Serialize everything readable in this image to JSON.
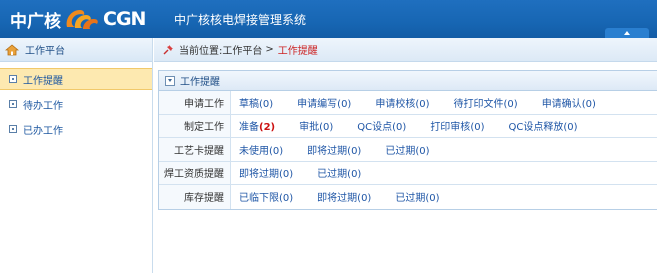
{
  "header": {
    "logo_cn": "中广核",
    "logo_en": "CGN",
    "system_title": "中广核核电焊接管理系统"
  },
  "sidebar": {
    "title": "工作平台",
    "items": [
      {
        "label": "工作提醒",
        "active": true
      },
      {
        "label": "待办工作",
        "active": false
      },
      {
        "label": "已办工作",
        "active": false
      }
    ]
  },
  "breadcrumb": {
    "prefix": "当前位置:",
    "path": "工作平台",
    "separator": ">",
    "current": "工作提醒"
  },
  "panel": {
    "title": "工作提醒",
    "rows": [
      {
        "label": "申请工作",
        "items": [
          {
            "text": "草稿",
            "count": "(0)"
          },
          {
            "text": "申请编写",
            "count": "(0)"
          },
          {
            "text": "申请校核",
            "count": "(0)"
          },
          {
            "text": "待打印文件",
            "count": "(0)"
          },
          {
            "text": "申请确认",
            "count": "(0)"
          }
        ]
      },
      {
        "label": "制定工作",
        "items": [
          {
            "text": "准备",
            "count": "(2)",
            "hot": true
          },
          {
            "text": "审批",
            "count": "(0)"
          },
          {
            "text": "QC设点",
            "count": "(0)"
          },
          {
            "text": "打印审核",
            "count": "(0)"
          },
          {
            "text": "QC设点释放",
            "count": "(0)"
          }
        ]
      },
      {
        "label": "工艺卡提醒",
        "items": [
          {
            "text": "未使用",
            "count": "(0)"
          },
          {
            "text": "即将过期",
            "count": "(0)"
          },
          {
            "text": "已过期",
            "count": "(0)"
          }
        ]
      },
      {
        "label": "焊工资质提醒",
        "items": [
          {
            "text": "即将过期",
            "count": "(0)"
          },
          {
            "text": "已过期",
            "count": "(0)"
          }
        ]
      },
      {
        "label": "库存提醒",
        "items": [
          {
            "text": "已临下限",
            "count": "(0)"
          },
          {
            "text": "即将过期",
            "count": "(0)"
          },
          {
            "text": "已过期",
            "count": "(0)"
          }
        ]
      }
    ]
  },
  "colors": {
    "header_bg": "#1766b3",
    "link": "#1f56a6",
    "alert": "#cc1111",
    "active_bg": "#fde9b0"
  }
}
